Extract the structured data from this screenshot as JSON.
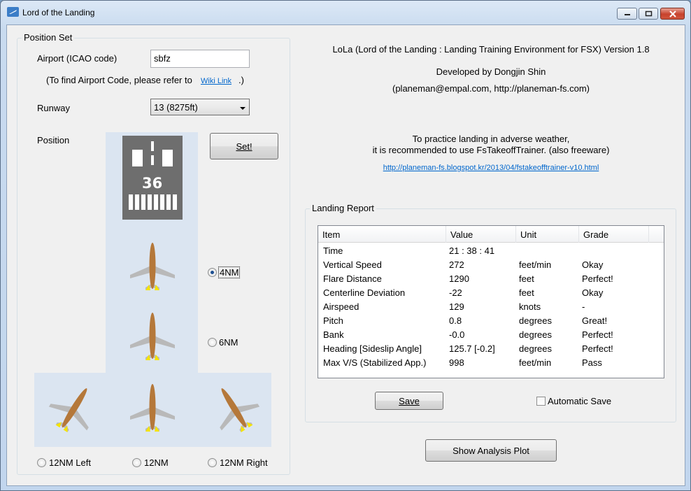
{
  "window": {
    "title": "Lord of the Landing"
  },
  "position_set": {
    "group_label": "Position Set",
    "airport_label": "Airport (ICAO code)",
    "airport_value": "sbfz",
    "airport_hint_prefix": "(To find Airport Code, please refer to",
    "wiki_link": "Wiki Link",
    "airport_hint_suffix": ".)",
    "runway_label": "Runway",
    "runway_value": "13 (8275ft)",
    "position_label": "Position",
    "set_button": "Set!",
    "runway_number": "36",
    "options": {
      "nm4": {
        "label": "4NM",
        "checked": true
      },
      "nm6": {
        "label": "6NM",
        "checked": false
      },
      "nm12_left": {
        "label": "12NM Left",
        "checked": false
      },
      "nm12": {
        "label": "12NM",
        "checked": false
      },
      "nm12_right": {
        "label": "12NM Right",
        "checked": false
      }
    }
  },
  "about": {
    "line1": "LoLa (Lord of the Landing : Landing Training Environment for FSX) Version 1.8",
    "line2": "Developed by Dongjin Shin",
    "line3": "(planeman@empal.com, http://planeman-fs.com)",
    "line4": "To practice landing in adverse weather,",
    "line5": "it is recommended to use FsTakeoffTrainer. (also freeware)",
    "link": "http://planeman-fs.blogspot.kr/2013/04/fstakeofftrainer-v10.html"
  },
  "landing_report": {
    "group_label": "Landing Report",
    "columns": [
      "Item",
      "Value",
      "Unit",
      "Grade"
    ],
    "rows": [
      [
        "Time",
        "21 : 38 : 41",
        "",
        ""
      ],
      [
        "Vertical Speed",
        "272",
        "feet/min",
        "Okay"
      ],
      [
        "Flare Distance",
        "1290",
        "feet",
        "Perfect!"
      ],
      [
        "Centerline Deviation",
        "-22",
        "feet",
        "Okay"
      ],
      [
        "Airspeed",
        "129",
        "knots",
        "-"
      ],
      [
        "Pitch",
        "0.8",
        "degrees",
        "Great!"
      ],
      [
        "Bank",
        "-0.0",
        "degrees",
        "Perfect!"
      ],
      [
        "Heading [Sideslip Angle]",
        "125.7 [-0.2]",
        "degrees",
        "Perfect!"
      ],
      [
        "Max V/S (Stabilized App.)",
        "998",
        "feet/min",
        "Pass"
      ]
    ],
    "save_button": "Save",
    "automatic_save_label": "Automatic Save",
    "automatic_save_checked": false
  },
  "analysis_button": "Show Analysis Plot",
  "colors": {
    "pad": "#dbe5f1",
    "runway": "#6e6e6e",
    "fuselage": "#b5783a",
    "wing": "#b9b9b9",
    "exhaust": "#f5e400"
  }
}
